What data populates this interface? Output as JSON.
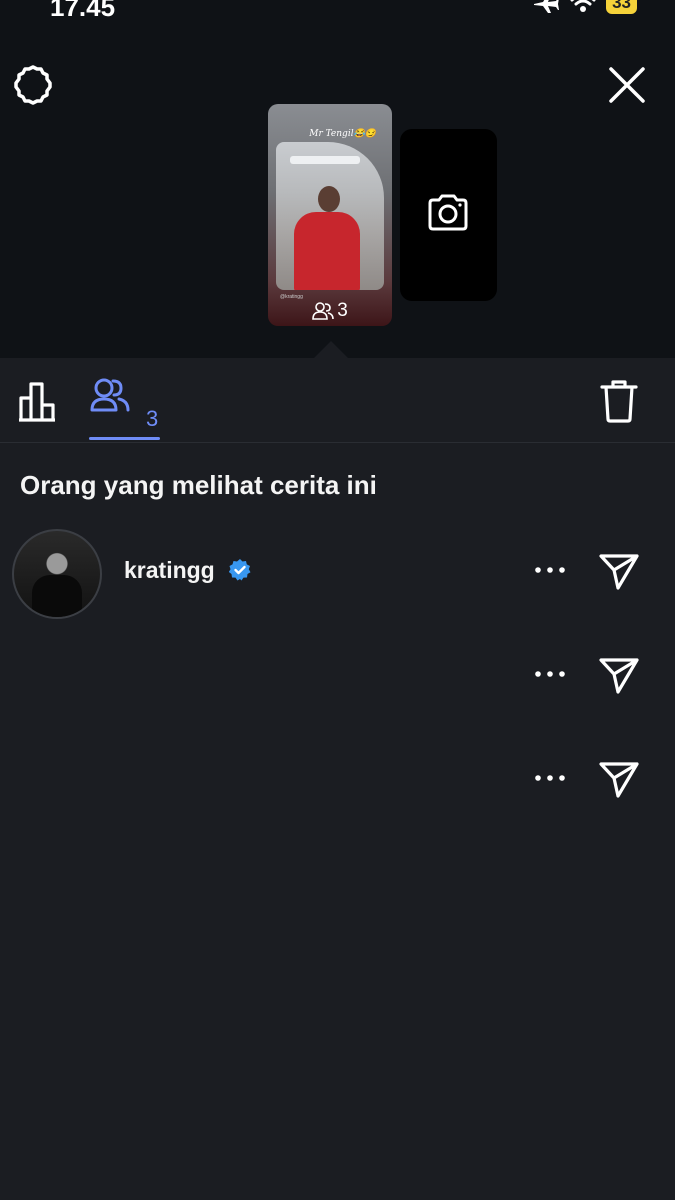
{
  "status_bar": {
    "time": "17.45",
    "battery": "33"
  },
  "story": {
    "caption": "Mr Tengil😂😏",
    "tag": "@kratingg",
    "view_count": "3"
  },
  "tabs": {
    "viewers_count": "3"
  },
  "section_title": "Orang yang melihat cerita ini",
  "viewers": [
    {
      "username": "kratingg",
      "verified": true
    },
    {
      "username": "",
      "verified": false
    },
    {
      "username": "",
      "verified": false
    }
  ],
  "colors": {
    "accent": "#6f8cf6",
    "verified": "#3897f0",
    "background": "#1b1d22",
    "top_background": "#0f1216"
  },
  "icons": {
    "settings": "gear-icon",
    "close": "close-icon",
    "camera": "camera-icon",
    "insights": "bar-chart-icon",
    "viewers": "people-icon",
    "delete": "trash-icon",
    "more": "more-horizontal-icon",
    "send": "send-icon"
  }
}
